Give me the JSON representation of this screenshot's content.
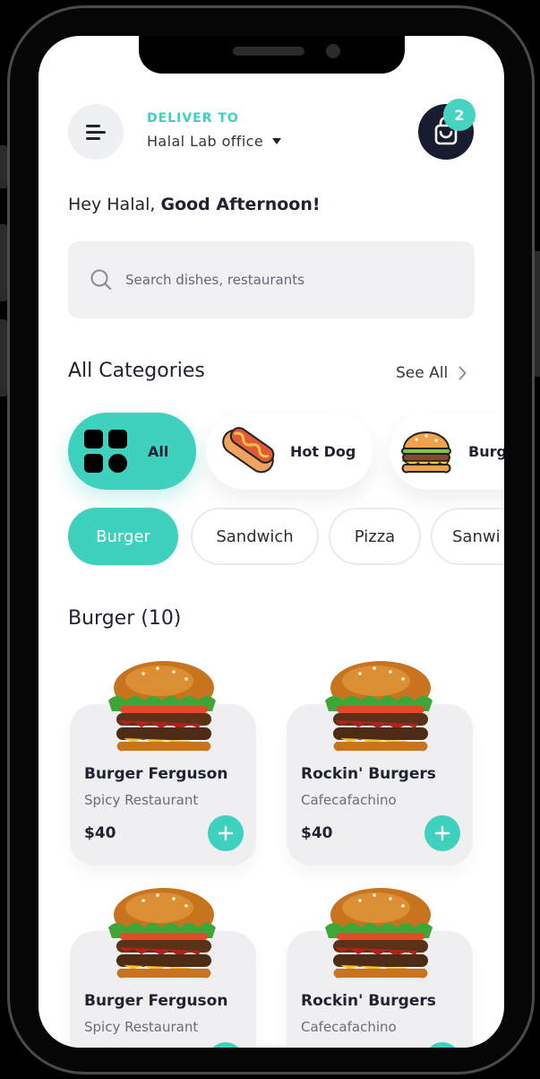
{
  "header": {
    "deliver_label": "DELIVER TO",
    "location": "Halal Lab office",
    "cart_count": "2"
  },
  "greeting": {
    "prefix": "Hey Halal, ",
    "emphasis": "Good Afternoon!"
  },
  "search": {
    "placeholder": "Search dishes, restaurants"
  },
  "categories": {
    "title": "All Categories",
    "see_all": "See All",
    "items": [
      {
        "label": "All",
        "icon": "grid-icon",
        "active": true
      },
      {
        "label": "Hot Dog",
        "icon": "hot-dog-icon",
        "active": false
      },
      {
        "label": "Burg",
        "icon": "burger-icon",
        "active": false
      }
    ]
  },
  "filters": [
    {
      "label": "Burger",
      "active": true
    },
    {
      "label": "Sandwich",
      "active": false
    },
    {
      "label": "Pizza",
      "active": false
    },
    {
      "label": "Sanwi",
      "active": false
    }
  ],
  "section": {
    "title": "Burger (10)"
  },
  "products": [
    {
      "name": "Burger Ferguson",
      "restaurant": "Spicy Restaurant",
      "price": "$40"
    },
    {
      "name": "Rockin' Burgers",
      "restaurant": "Cafecafachino",
      "price": "$40"
    },
    {
      "name": "Burger Ferguson",
      "restaurant": "Spicy Restaurant",
      "price": ""
    },
    {
      "name": "Rockin' Burgers",
      "restaurant": "Cafecafachino",
      "price": ""
    }
  ],
  "colors": {
    "accent": "#3ed1be",
    "dark": "#181c2e",
    "text": "#1f2230"
  }
}
